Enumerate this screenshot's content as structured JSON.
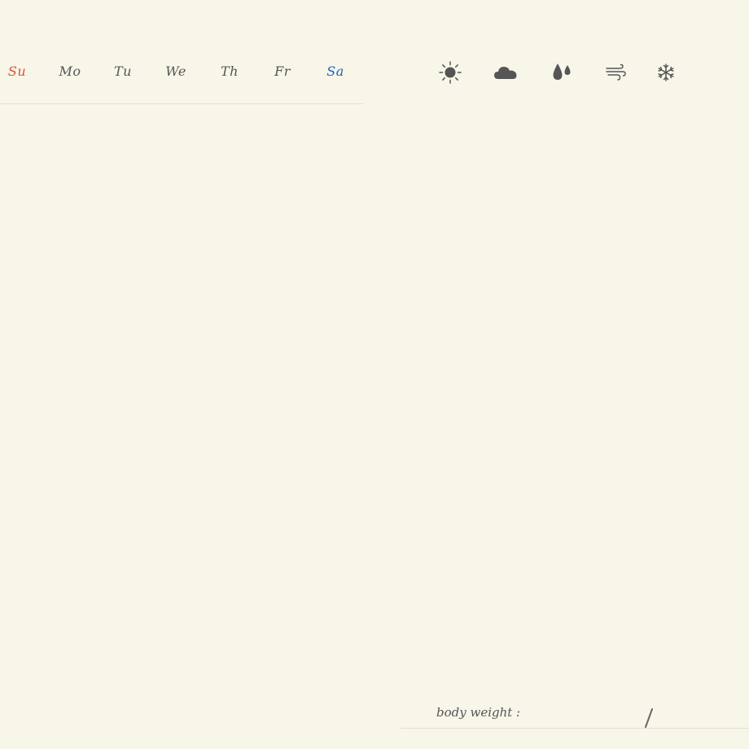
{
  "weekdays": [
    {
      "label": "Su",
      "color": "#d9562f"
    },
    {
      "label": "Mo",
      "color": "#555555"
    },
    {
      "label": "Tu",
      "color": "#555555"
    },
    {
      "label": "We",
      "color": "#555555"
    },
    {
      "label": "Th",
      "color": "#555555"
    },
    {
      "label": "Fr",
      "color": "#555555"
    },
    {
      "label": "Sa",
      "color": "#1f63b8"
    }
  ],
  "weather_icons": [
    "sun-icon",
    "cloud-icon",
    "rain-drops-icon",
    "wind-icon",
    "snowflake-icon"
  ],
  "body_weight": {
    "label": "body weight :",
    "value": "",
    "target": "",
    "separator": "/"
  },
  "colors": {
    "background": "#f8f5e9",
    "ink": "#555555",
    "sunday": "#d9562f",
    "saturday": "#1f63b8",
    "rule": "#e4e0d3"
  }
}
